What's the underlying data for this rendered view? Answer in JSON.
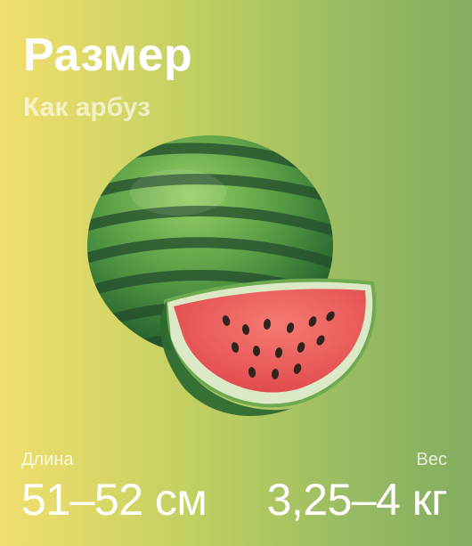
{
  "header": {
    "title": "Размер",
    "subtitle": "Как арбуз"
  },
  "illustration": {
    "icon": "watermelon-icon"
  },
  "stats": {
    "length": {
      "label": "Длина",
      "value": "51–52 см"
    },
    "weight": {
      "label": "Вес",
      "value": "3,25–4 кг"
    }
  },
  "colors": {
    "gradient_start": "#f1df6e",
    "gradient_end": "#84ad60",
    "watermelon_dark": "#1f5a2c",
    "watermelon_light": "#7fbe58",
    "flesh": "#ef5b5f"
  }
}
